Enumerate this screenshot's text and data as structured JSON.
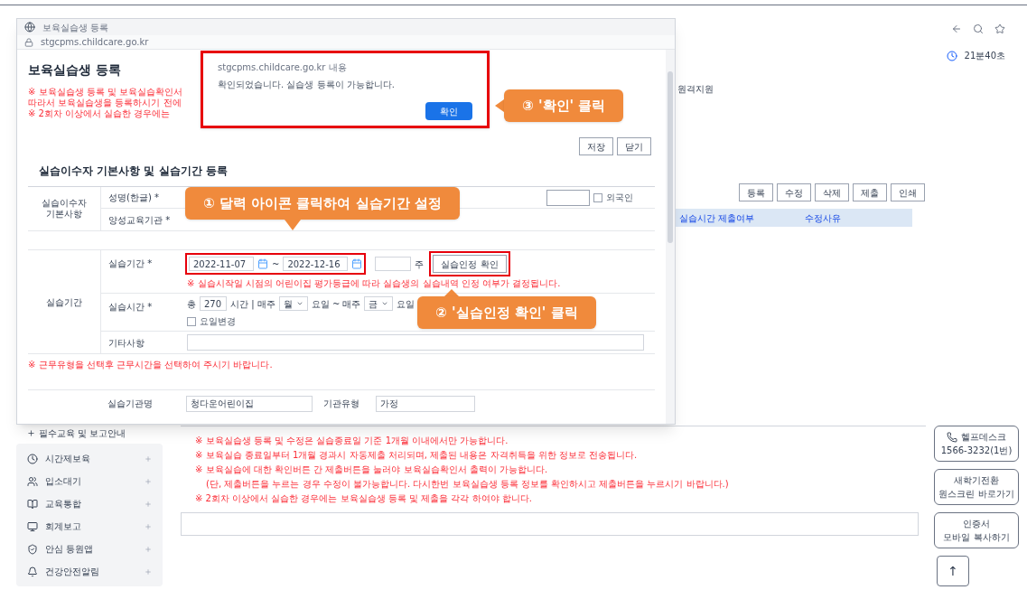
{
  "page": {
    "timer": "21분40초",
    "remote_support": "원격지원",
    "toolbar_buttons": [
      "등록",
      "수정",
      "삭제",
      "제출",
      "인쇄"
    ],
    "table_columns": [
      "실습시간 제출여부",
      "수정사유"
    ],
    "sidebar": {
      "sub_item": "필수교육 및 보고안내",
      "items": [
        "시간제보육",
        "입소대기",
        "교육통합",
        "회계보고",
        "안심 등원앱",
        "건강안전알림"
      ]
    },
    "notes": [
      "※ 보육실습생 등록 및 수정은 실습종료일 기준 1개월 이내에서만 가능합니다.",
      "※ 보육실습 종료일부터 1개월 경과시 자동제출 처리되며, 제출된 내용은 자격취득을 위한 정보로 전송됩니다.",
      "※ 보육실습에 대한 확인버튼 간 제출버튼을 눌러야 보육실습확인서 출력이 가능합니다.",
      "(단, 제출버튼을 누르는 경우 수정이 불가능합니다. 다시한번 보육실습생 등록 정보를 확인하시고 제출버튼을 누르시기 바랍니다.)",
      "※ 2회차 이상에서 실습한 경우에는 보육실습생 등록 및 제출을 각각 하여야 합니다."
    ],
    "quick_links": [
      {
        "kind": "phone",
        "title": "헬프데스크",
        "subtitle": "1566-3232(1번)"
      },
      {
        "kind": "text",
        "title": "새학기전환",
        "subtitle": "원스크린 바로가기"
      },
      {
        "kind": "text",
        "title": "인증서",
        "subtitle": "모바일 복사하기"
      },
      {
        "kind": "top",
        "title": "↑"
      }
    ]
  },
  "popup": {
    "tab_title": "보육실습생 등록",
    "url": "stgcpms.childcare.go.kr",
    "heading": "보육실습생 등록",
    "notes": [
      "※ 보육실습생 등록 및 보육실습확인서",
      "따라서 보육실습생을 등록하시기 전에",
      "※ 2회차 이상에서 실습한 경우에는"
    ],
    "buttons": [
      "저장",
      "닫기"
    ],
    "section_title": "실습이수자 기본사항 및 실습기간 등록",
    "basic": {
      "group": "실습이수자 기본사항",
      "name_label": "성명(한글) *",
      "school_label": "양성교육기관 *",
      "foreigner": {
        "label": "외국인",
        "checked": false
      }
    },
    "period": {
      "group": "실습기간",
      "period_label": "실습기간 *",
      "start": "2022-11-07",
      "tilde": "~",
      "end": "2022-12-16",
      "weeks_unit": "주",
      "confirm_button": "실습인정 확인",
      "period_note": "※ 실습시작일 시점의 어린이집 평가등급에 따라 실습생의 실습내역 인정 여부가 결정됩니다.",
      "hours_label": "실습시간 *",
      "total": "총",
      "hours": "270",
      "hours_text": "시간 | 매주",
      "day_from": "월",
      "day_sep": "요일 ~ 매주",
      "day_to": "금",
      "day_end": "요일",
      "day_change": {
        "label": "요일변경",
        "checked": false
      },
      "etc_label": "기타사항"
    },
    "work_note": "※ 근무유형을 선택후 근무시간을 선택하여 주시기 바랍니다.",
    "org": {
      "label": "실습기관명",
      "value": "청다운어린이집",
      "type_label": "기관유형",
      "type_value": "가정"
    }
  },
  "alert": {
    "origin": "stgcpms.childcare.go.kr 내용",
    "message": "확인되었습니다. 실습생 등록이 가능합니다.",
    "button": "확인"
  },
  "callouts": [
    "③ '확인' 클릭",
    "① 달력 아이콘 클릭하여 실습기간 설정",
    "② '실습인정 확인' 클릭"
  ]
}
